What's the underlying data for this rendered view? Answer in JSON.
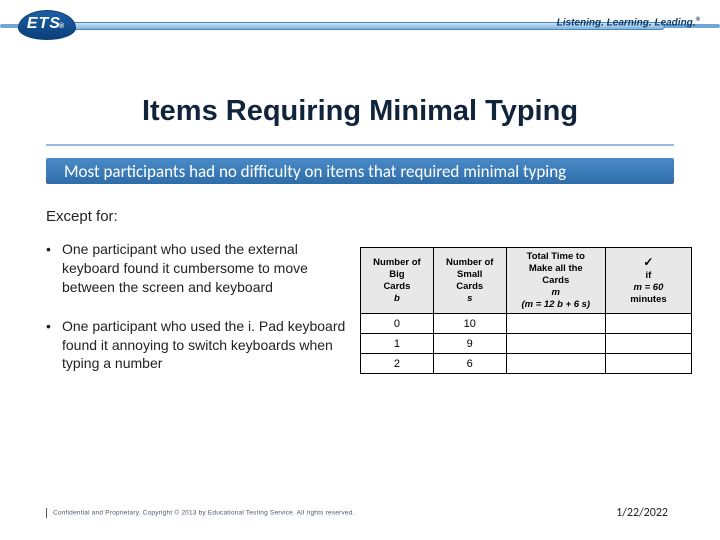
{
  "header": {
    "logo_text": "ETS",
    "tagline": "Listening. Learning. Leading."
  },
  "title": "Items Requiring Minimal Typing",
  "banner": "Most participants had no difficulty on items that required minimal typing",
  "except_label": "Except for:",
  "bullets": [
    "One participant who used the external keyboard found it cumbersome to move between the screen and keyboard",
    "One participant who used the i. Pad keyboard found it annoying to switch keyboards when typing a number"
  ],
  "table": {
    "headers": {
      "col1_l1": "Number of",
      "col1_l2": "Big",
      "col1_l3": "Cards",
      "col1_var": "b",
      "col2_l1": "Number of",
      "col2_l2": "Small",
      "col2_l3": "Cards",
      "col2_var": "s",
      "col3_l1": "Total Time to",
      "col3_l2": "Make all the",
      "col3_l3": "Cards",
      "col3_var": "m",
      "col3_formula": "(m = 12 b + 6 s)",
      "col4_check": "✓",
      "col4_l1": "if",
      "col4_cond": "m = 60",
      "col4_l2": "minutes"
    },
    "rows": [
      {
        "b": "0",
        "s": "10",
        "m": "",
        "chk": ""
      },
      {
        "b": "1",
        "s": "9",
        "m": "",
        "chk": ""
      },
      {
        "b": "2",
        "s": "6",
        "m": "",
        "chk": ""
      }
    ]
  },
  "footer": {
    "confidential": "Confidential and Proprietary. Copyright © 2013 by Educational Testing Service. All rights reserved.",
    "date": "1/22/2022"
  }
}
